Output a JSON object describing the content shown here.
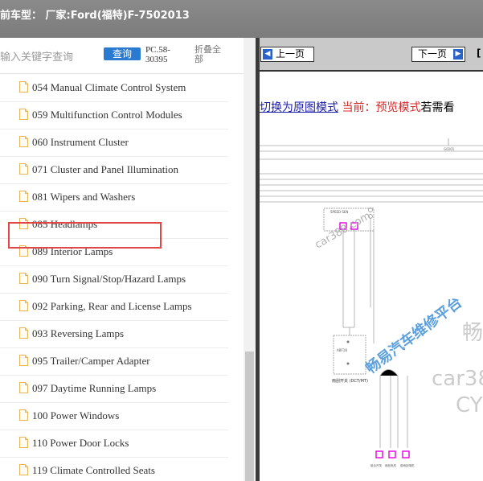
{
  "header": {
    "title": "前车型：  厂家:Ford(福特)F-7502013"
  },
  "search": {
    "placeholder": "输入关键字查询",
    "button_label": "查询",
    "code": "PC.58-30395",
    "fold_label": "折叠全部"
  },
  "tree": {
    "items": [
      {
        "label": "054 Manual Climate Control System"
      },
      {
        "label": "059 Multifunction Control Modules"
      },
      {
        "label": "060 Instrument Cluster"
      },
      {
        "label": "071 Cluster and Panel Illumination"
      },
      {
        "label": "081 Wipers and Washers"
      },
      {
        "label": "085 Headlamps"
      },
      {
        "label": "089 Interior Lamps"
      },
      {
        "label": "090 Turn Signal/Stop/Hazard Lamps"
      },
      {
        "label": "092 Parking, Rear and License Lamps"
      },
      {
        "label": "093 Reversing Lamps"
      },
      {
        "label": "095 Trailer/Camper Adapter"
      },
      {
        "label": "097 Daytime Running Lamps"
      },
      {
        "label": "100 Power Windows"
      },
      {
        "label": "110 Power Door Locks"
      },
      {
        "label": "119 Climate Controlled Seats"
      }
    ],
    "highlighted_index": 4
  },
  "viewer": {
    "prev_label": "上一页",
    "next_label": "下一页",
    "bracket_text": "[",
    "switch_link": "切换为原图模式",
    "current_mode": "当前：预览模式",
    "rest_text": "若需看",
    "watermarks": {
      "wm1": "car388.com",
      "wm2": "畅易汽车维修平台",
      "wm3": "畅",
      "wm4": "car38",
      "wm5": "CY"
    },
    "diagram_labels": {
      "gnd": "G0201",
      "sw_title": "SPEED SEN",
      "sw_label": "雨刮开关 (DCT/MT)",
      "relay": "ABF18",
      "bottom_left": "组合开关",
      "bottom_mid": "雨刮电机",
      "bottom_right": "前雨刮电机"
    }
  },
  "colors": {
    "header_bg": "#828282",
    "accent_blue": "#2a7ad1",
    "highlight_red": "#e04848",
    "connector_magenta": "#e000e0",
    "watermark_blue": "#3f8fd8"
  }
}
